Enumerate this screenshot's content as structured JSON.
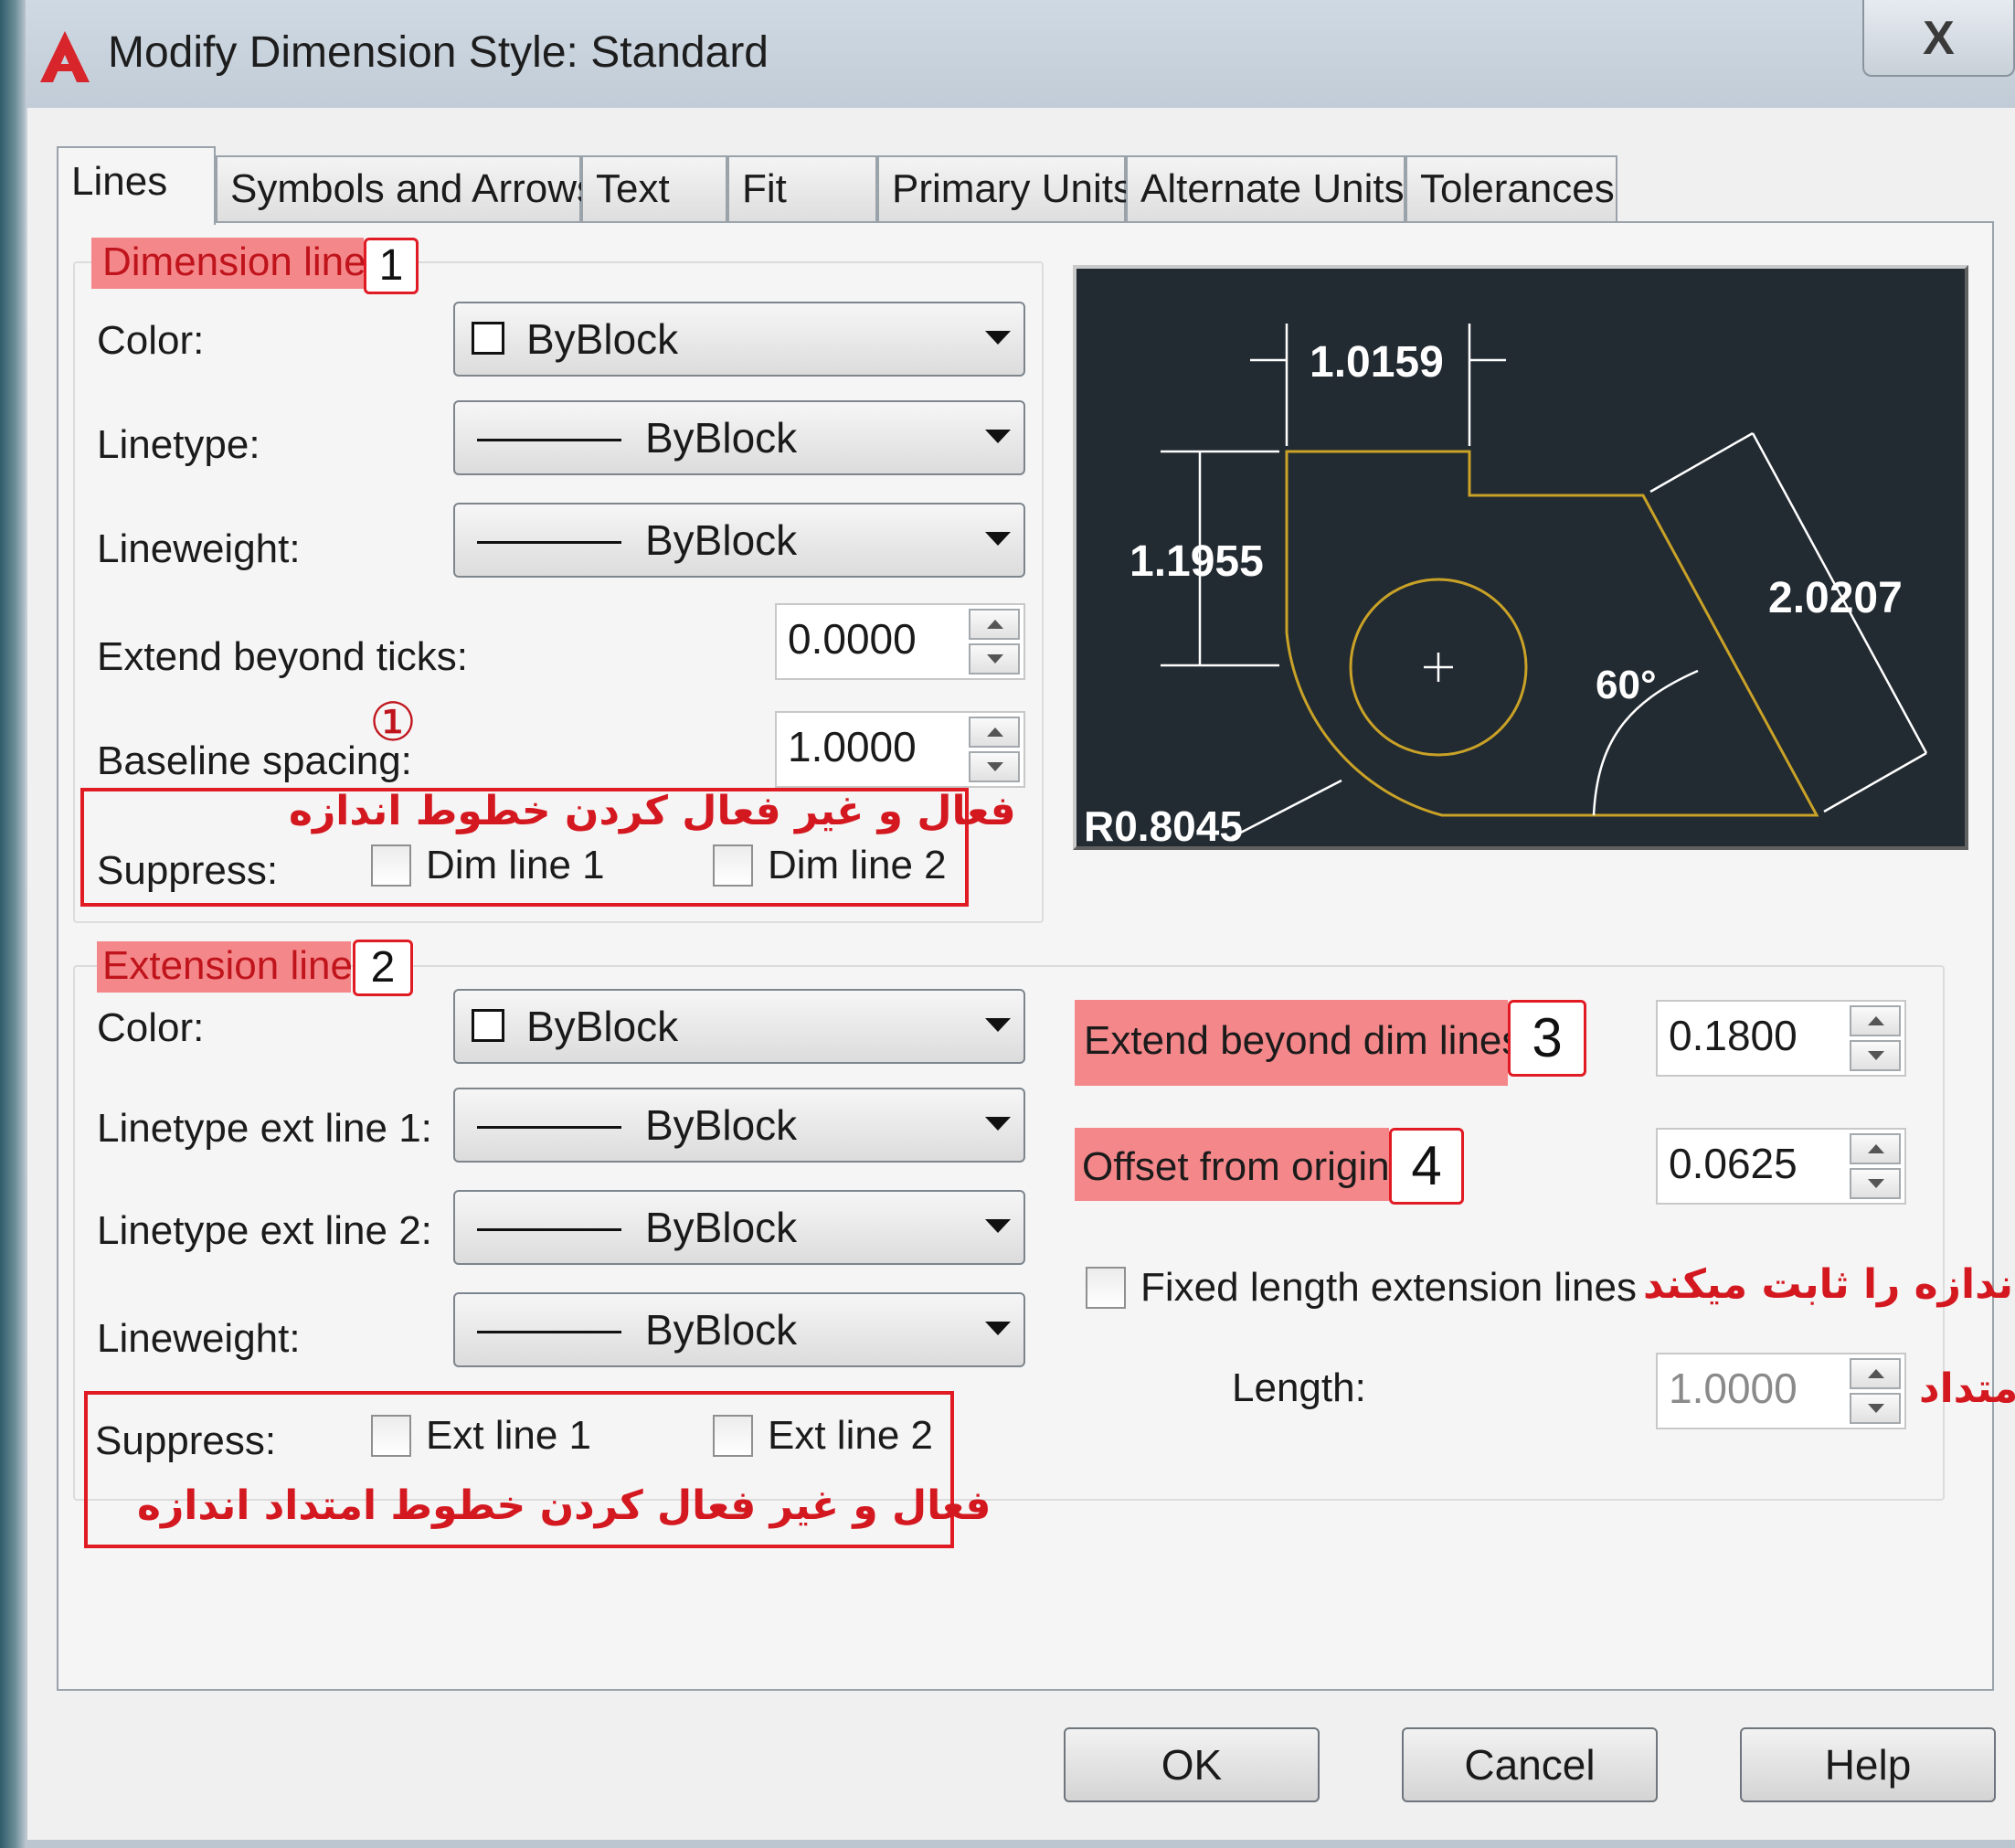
{
  "window": {
    "title": "Modify Dimension Style: Standard",
    "close_glyph": "X",
    "logo_letter": "A"
  },
  "tabs": [
    {
      "label": "Lines"
    },
    {
      "label": "Symbols and Arrows"
    },
    {
      "label": "Text"
    },
    {
      "label": "Fit"
    },
    {
      "label": "Primary Units"
    },
    {
      "label": "Alternate Units"
    },
    {
      "label": "Tolerances"
    }
  ],
  "dimension_lines": {
    "title": "Dimension lines",
    "badge": "1",
    "color_label": "Color:",
    "color_value": "ByBlock",
    "linetype_label": "Linetype:",
    "linetype_value": "ByBlock",
    "lineweight_label": "Lineweight:",
    "lineweight_value": "ByBlock",
    "extend_label": "Extend beyond ticks:",
    "extend_value": "0.0000",
    "baseline_label": "Baseline spacing:",
    "baseline_value": "1.0000",
    "circled_marker": "①",
    "suppress_label": "Suppress:",
    "dim_line_1": "Dim line 1",
    "dim_line_2": "Dim line 2",
    "note_fa": "فعال و غیر فعال کردن خطوط اندازه"
  },
  "extension_lines": {
    "title": "Extension lines",
    "badge": "2",
    "color_label": "Color:",
    "color_value": "ByBlock",
    "linetype1_label": "Linetype ext line 1:",
    "linetype1_value": "ByBlock",
    "linetype2_label": "Linetype ext line 2:",
    "linetype2_value": "ByBlock",
    "lineweight_label": "Lineweight:",
    "lineweight_value": "ByBlock",
    "suppress_label": "Suppress:",
    "ext_line_1": "Ext line 1",
    "ext_line_2": "Ext line 2",
    "note_fa": "فعال و غیر فعال کردن خطوط امتداد اندازه",
    "extend_beyond_label": "Extend beyond dim lines:",
    "extend_beyond_badge": "3",
    "extend_beyond_value": "0.1800",
    "offset_label": "Offset from origin:",
    "offset_badge": "4",
    "offset_value": "0.0625",
    "fixed_length_label": "Fixed length extension lines",
    "fixed_note_fa": "اندازه را ثابت میکند",
    "length_label": "Length:",
    "length_value": "1.0000",
    "length_note_fa": "متداد"
  },
  "preview": {
    "dim_top": "1.0159",
    "dim_left": "1.1955",
    "dim_right": "2.0207",
    "angle": "60°",
    "radius": "R0.8045"
  },
  "buttons": {
    "ok": "OK",
    "cancel": "Cancel",
    "help": "Help"
  },
  "colors": {
    "annotation_red": "#e01b24",
    "highlight_pink": "#f4878a",
    "preview_bg": "#232b32",
    "preview_geometry": "#c9a227"
  }
}
